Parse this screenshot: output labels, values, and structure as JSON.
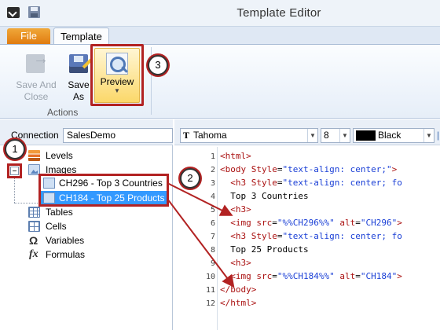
{
  "window": {
    "title": "Template Editor"
  },
  "tabs": {
    "file": "File",
    "template": "Template"
  },
  "ribbon": {
    "save_and_close": [
      "Save And",
      "Close"
    ],
    "save_as": [
      "Save",
      "As"
    ],
    "preview": "Preview",
    "group_label": "Actions"
  },
  "connection": {
    "label": "Connection",
    "value": "SalesDemo"
  },
  "tree": {
    "levels": "Levels",
    "images": "Images",
    "image_children": [
      "CH296 - Top 3 Countries",
      "CH184 - Top 25 Products"
    ],
    "tables": "Tables",
    "cells": "Cells",
    "variables": "Variables",
    "formulas": "Formulas"
  },
  "toolbar": {
    "font": "Tahoma",
    "size": "8",
    "color": "Black"
  },
  "code_lines": [
    {
      "n": "1",
      "parts": [
        [
          "tag",
          "<html>"
        ]
      ]
    },
    {
      "n": "2",
      "parts": [
        [
          "tag",
          "<body "
        ],
        [
          "attr",
          "Style"
        ],
        [
          "txt",
          "="
        ],
        [
          "str",
          "\"text-align: center;\""
        ],
        [
          "tag",
          ">"
        ]
      ]
    },
    {
      "n": "3",
      "parts": [
        [
          "txt",
          "  "
        ],
        [
          "tag",
          "<h3 "
        ],
        [
          "attr",
          "Style"
        ],
        [
          "txt",
          "="
        ],
        [
          "str",
          "\"text-align: center; fo"
        ]
      ]
    },
    {
      "n": "4",
      "parts": [
        [
          "txt",
          "  Top 3 Countries"
        ]
      ]
    },
    {
      "n": "5",
      "parts": [
        [
          "txt",
          "  "
        ],
        [
          "tag",
          "<h3>"
        ]
      ]
    },
    {
      "n": "6",
      "parts": [
        [
          "txt",
          "  "
        ],
        [
          "tag",
          "<img "
        ],
        [
          "attr",
          "src"
        ],
        [
          "txt",
          "="
        ],
        [
          "str",
          "\"%%CH296%%\""
        ],
        [
          "txt",
          " "
        ],
        [
          "attr",
          "alt"
        ],
        [
          "txt",
          "="
        ],
        [
          "str",
          "\"CH296\""
        ],
        [
          "tag",
          ">"
        ]
      ]
    },
    {
      "n": "7",
      "parts": [
        [
          "txt",
          "  "
        ],
        [
          "tag",
          "<h3 "
        ],
        [
          "attr",
          "Style"
        ],
        [
          "txt",
          "="
        ],
        [
          "str",
          "\"text-align: center; fo"
        ]
      ]
    },
    {
      "n": "8",
      "parts": [
        [
          "txt",
          "  Top 25 Products"
        ]
      ]
    },
    {
      "n": "9",
      "parts": [
        [
          "txt",
          "  "
        ],
        [
          "tag",
          "<h3>"
        ]
      ]
    },
    {
      "n": "10",
      "parts": [
        [
          "txt",
          "  "
        ],
        [
          "tag",
          "<img "
        ],
        [
          "attr",
          "src"
        ],
        [
          "txt",
          "="
        ],
        [
          "str",
          "\"%%CH184%%\""
        ],
        [
          "txt",
          " "
        ],
        [
          "attr",
          "alt"
        ],
        [
          "txt",
          "="
        ],
        [
          "str",
          "\"CH184\""
        ],
        [
          "tag",
          ">"
        ]
      ]
    },
    {
      "n": "11",
      "parts": [
        [
          "tag",
          "</body>"
        ]
      ]
    },
    {
      "n": "12",
      "parts": [
        [
          "tag",
          "</html>"
        ]
      ]
    }
  ],
  "callouts": [
    "1",
    "2",
    "3"
  ],
  "colors": {
    "annotation_red": "#b22222",
    "selection_blue": "#3399ff",
    "file_tab_orange": "#e8891f"
  }
}
